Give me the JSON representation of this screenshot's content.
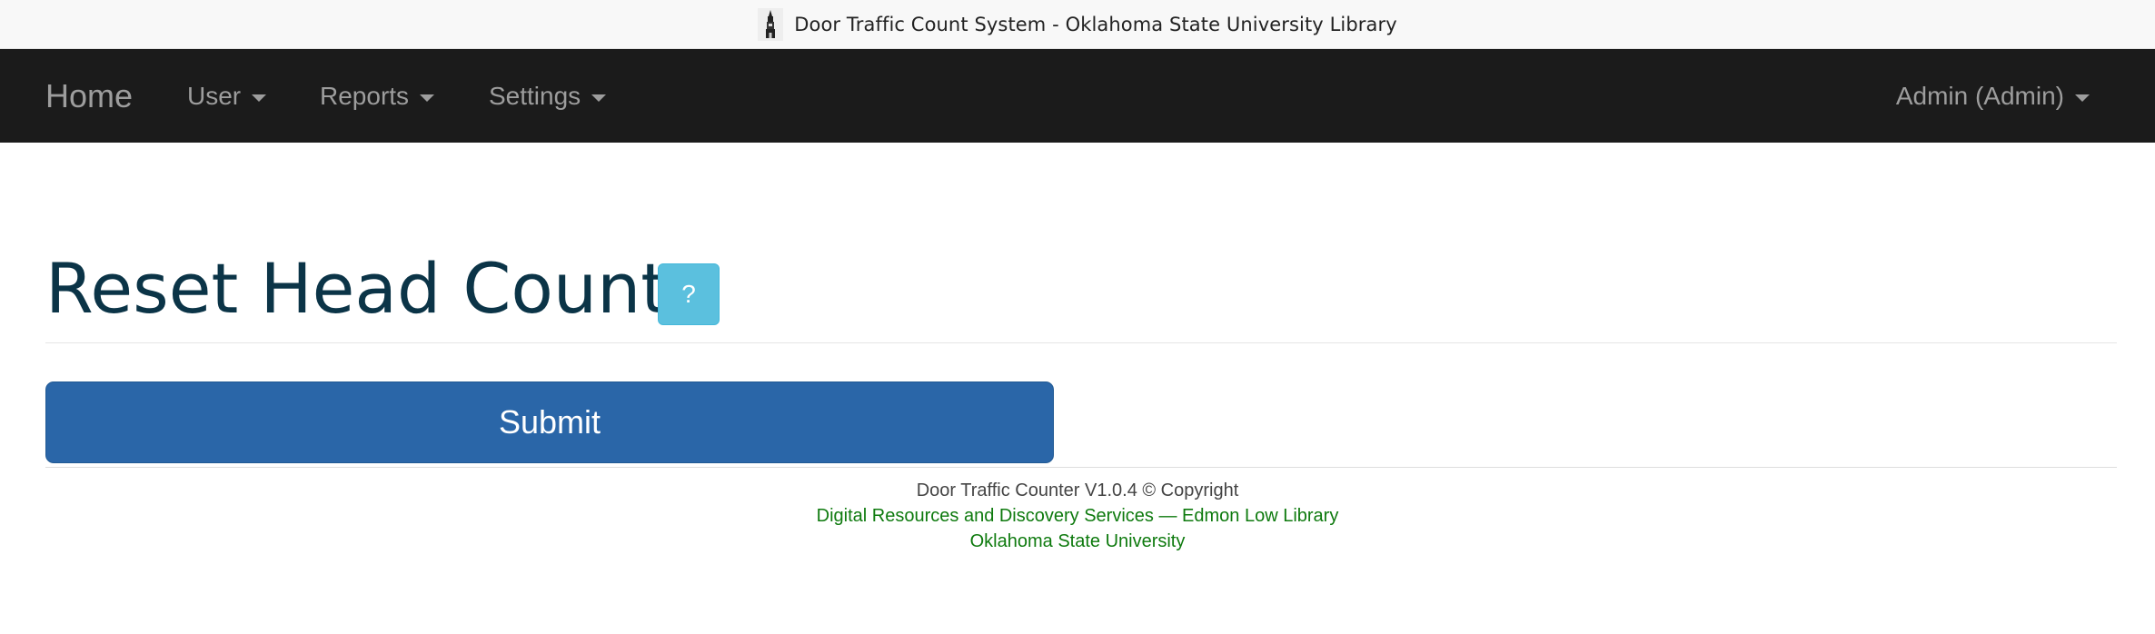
{
  "title_bar": {
    "logo_icon": "library-tower-icon",
    "text": "Door Traffic Count System - Oklahoma State University Library"
  },
  "navbar": {
    "brand": "Home",
    "items": [
      {
        "label": "User"
      },
      {
        "label": "Reports"
      },
      {
        "label": "Settings"
      }
    ],
    "account_label": "Admin (Admin)"
  },
  "page": {
    "title": "Reset Head Count",
    "help_label": "?",
    "submit_label": "Submit"
  },
  "footer": {
    "line1": "Door Traffic Counter V1.0.4 © Copyright",
    "line2": "Digital Resources and Discovery Services — Edmon Low Library",
    "line3": "Oklahoma State University"
  },
  "colors": {
    "navbar_bg": "#1b1b1b",
    "title_color": "#0b3447",
    "help_button": "#5bc0de",
    "submit_button": "#2a66a8",
    "footer_link": "#0e7a0e"
  }
}
